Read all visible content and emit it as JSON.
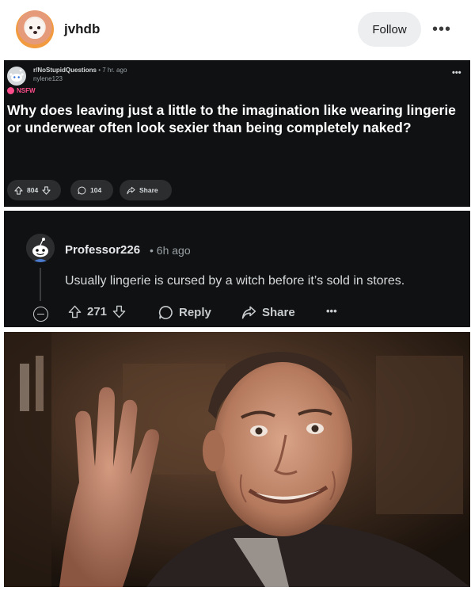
{
  "header": {
    "username": "jvhdb",
    "follow_label": "Follow",
    "more_label": "•••"
  },
  "post": {
    "subreddit": "r/NoStupidQuestions",
    "time": "• 7 hr. ago",
    "author": "nylene123",
    "flag": "NSFW",
    "more_label": "•••",
    "title": "Why does leaving just a little to the imagination like wearing lingerie or underwear often look sexier than being completely naked?",
    "votes": "804",
    "comments": "104",
    "share_label": "Share"
  },
  "comment": {
    "username": "Professor226",
    "time": "•  6h ago",
    "body": "Usually lingerie is cursed by a witch before it’s sold in stores.",
    "votes": "271",
    "reply_label": "Reply",
    "share_label": "Share",
    "more_label": "•••"
  },
  "colors": {
    "card_bg": "#0f1112",
    "pill_bg": "#2b2d2f",
    "nsfw": "#ff4d8b",
    "follow_bg": "#eceef0"
  },
  "icons": [
    "upvote-icon",
    "downvote-icon",
    "comment-icon",
    "share-icon",
    "collapse-icon",
    "reddit-snoo-icon"
  ]
}
